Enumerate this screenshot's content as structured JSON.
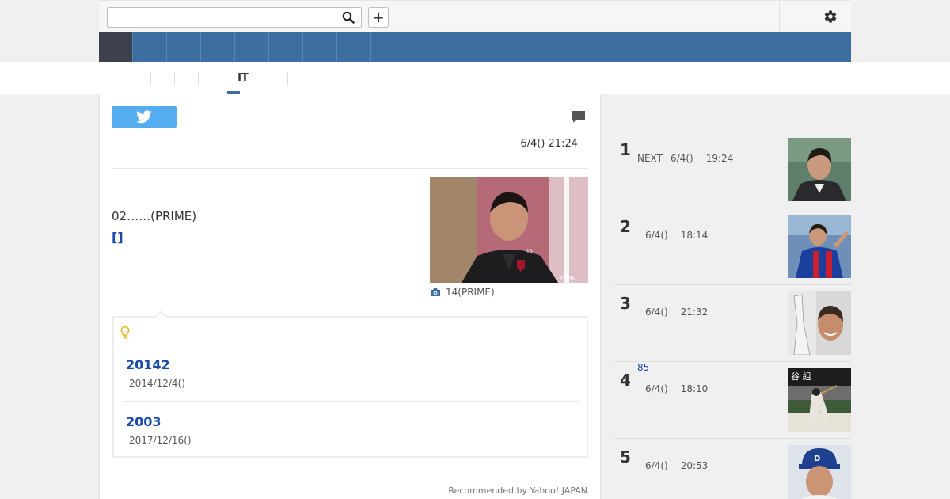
{
  "header": {
    "search": {
      "placeholder": "",
      "value": ""
    },
    "plus_label": "+"
  },
  "nav": {
    "item_count": 9,
    "active_index": 0
  },
  "subnav": {
    "items": [
      "",
      "",
      "",
      "",
      "",
      "IT",
      "",
      ""
    ],
    "active_index": 4
  },
  "article": {
    "date": "6/4() 21:24",
    "lead_text": "02……(PRIME)",
    "lead_link": "[]",
    "photo_caption": "14(PRIME)",
    "photo_watermark": "PRIME",
    "related": [
      {
        "title": "20142",
        "date": "2014/12/4()"
      },
      {
        "title": "2003",
        "date": "2017/12/16()"
      }
    ],
    "recommended": "Recommended by Yahoo! JAPAN"
  },
  "ranking": [
    {
      "rank": "1",
      "tag": "NEXT",
      "tag_style": "inline",
      "date": "6/4()",
      "time": "19:24"
    },
    {
      "rank": "2",
      "tag": "",
      "tag_style": "",
      "date": "6/4()",
      "time": "18:14"
    },
    {
      "rank": "3",
      "tag": "",
      "tag_style": "",
      "date": "6/4()",
      "time": "21:32"
    },
    {
      "rank": "4",
      "tag": "85",
      "tag_style": "blue",
      "date": "6/4()",
      "time": "18:10"
    },
    {
      "rank": "5",
      "tag": "",
      "tag_style": "",
      "date": "6/4()",
      "time": "20:53"
    }
  ],
  "colors": {
    "nav_blue": "#3d6ea1",
    "nav_active": "#3c414d",
    "link_blue": "#1a4aa8",
    "twitter_blue": "#55acee"
  },
  "icons": [
    "search-icon",
    "plus-icon",
    "gear-icon",
    "twitter-icon",
    "comment-icon",
    "camera-icon",
    "lightbulb-icon"
  ]
}
